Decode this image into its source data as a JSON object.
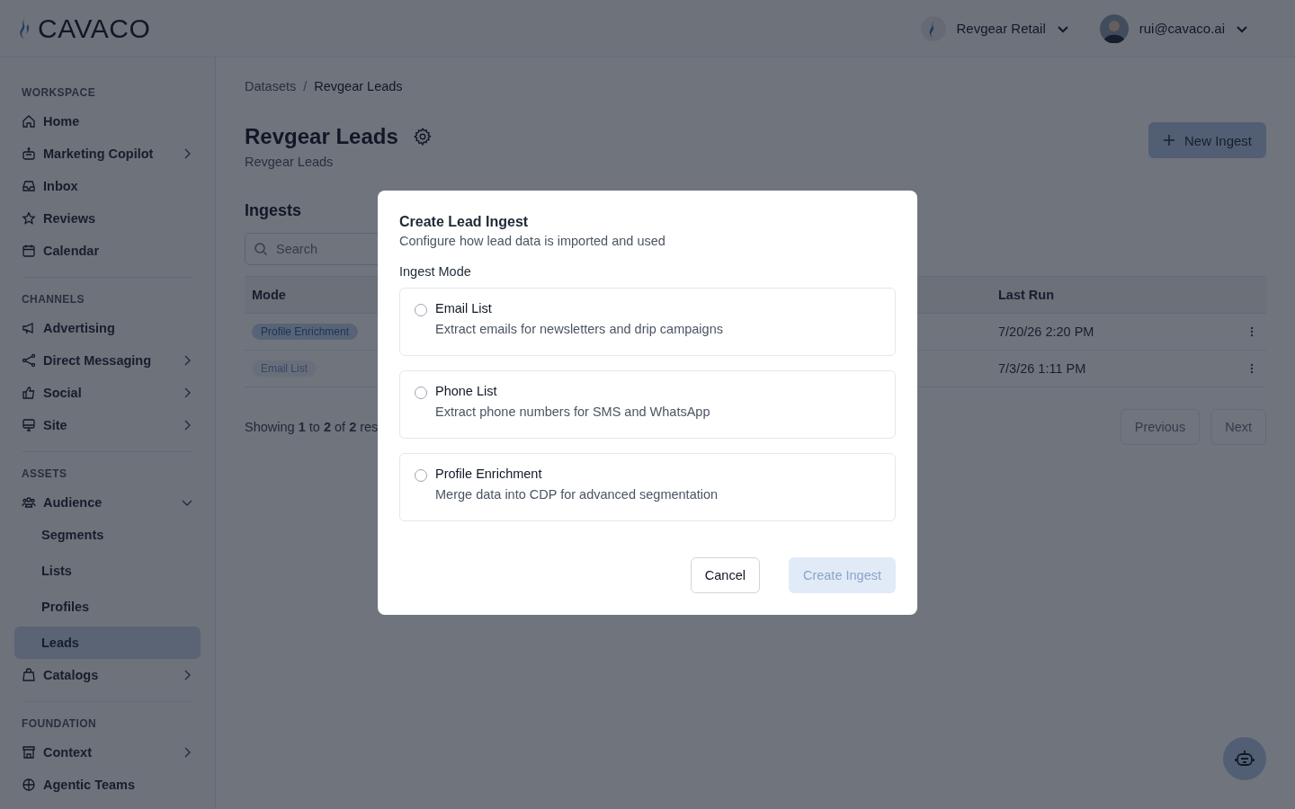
{
  "header": {
    "logo_text": "CAVACO",
    "workspace": "Revgear Retail",
    "user": "rui@cavaco.ai"
  },
  "sidebar": {
    "sections": [
      {
        "title": "WORKSPACE",
        "items": [
          {
            "label": "Home",
            "selected": false
          },
          {
            "label": "Marketing Copilot",
            "selected": false,
            "expanded": false
          },
          {
            "label": "Inbox",
            "selected": false
          },
          {
            "label": "Reviews",
            "selected": false
          },
          {
            "label": "Calendar",
            "selected": false
          }
        ]
      },
      {
        "title": "CHANNELS",
        "items": [
          {
            "label": "Advertising",
            "selected": false
          },
          {
            "label": "Direct Messaging",
            "selected": false,
            "expanded": false
          },
          {
            "label": "Social",
            "selected": false,
            "expanded": false
          },
          {
            "label": "Site",
            "selected": false,
            "expanded": false
          }
        ]
      },
      {
        "title": "ASSETS",
        "items": [
          {
            "label": "Audience",
            "selected": false,
            "expanded": true,
            "children": [
              {
                "label": "Segments",
                "selected": false
              },
              {
                "label": "Lists",
                "selected": false
              },
              {
                "label": "Profiles",
                "selected": false
              },
              {
                "label": "Leads",
                "selected": true
              }
            ]
          },
          {
            "label": "Catalogs",
            "selected": false,
            "expanded": false
          }
        ]
      },
      {
        "title": "FOUNDATION",
        "items": [
          {
            "label": "Context",
            "selected": false,
            "expanded": false
          },
          {
            "label": "Agentic Teams",
            "selected": false
          }
        ]
      }
    ]
  },
  "breadcrumb": {
    "separator": "/",
    "items": [
      "Datasets",
      "Revgear Leads"
    ]
  },
  "page": {
    "title": "Revgear Leads",
    "subtitle": "Revgear Leads",
    "new_button": "New Ingest"
  },
  "ingests": {
    "heading": "Ingests",
    "search": {
      "placeholder": "Search"
    },
    "columns": [
      "Mode",
      "Last Run"
    ],
    "rows": [
      {
        "mode": "Profile Enrichment",
        "active": true,
        "last_run": "7/20/26 2:20 PM"
      },
      {
        "mode": "Email List",
        "active": false,
        "last_run": "7/3/26 1:11 PM"
      }
    ],
    "summary": "Showing **1** to **2** of **2** res",
    "pagination": [
      {
        "label": "Previous",
        "disabled": true
      },
      {
        "label": "Next",
        "disabled": true
      }
    ]
  },
  "modal": {
    "title": "Create Lead Ingest",
    "description": "Configure how lead data is imported and used",
    "section_label": "Ingest Mode",
    "options": [
      {
        "label": "Email List",
        "description": "Extract emails for newsletters and drip campaigns",
        "selected": false
      },
      {
        "label": "Phone List",
        "description": "Extract phone numbers for SMS and WhatsApp",
        "selected": false
      },
      {
        "label": "Profile Enrichment",
        "description": "Merge data into CDP for advanced segmentation",
        "selected": false
      }
    ],
    "cancel": "Cancel",
    "submit": {
      "label": "Create Ingest",
      "disabled": true
    }
  }
}
